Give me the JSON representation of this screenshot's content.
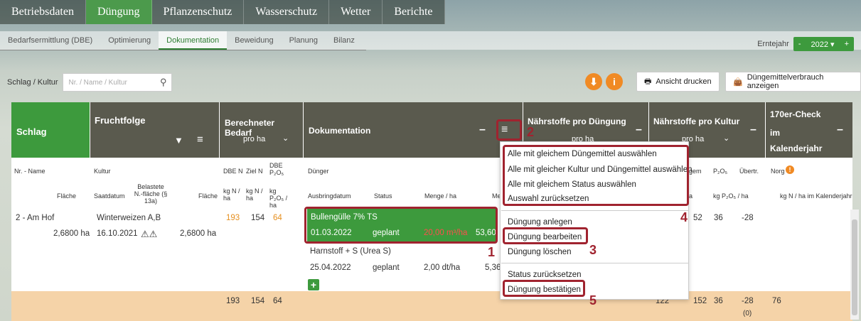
{
  "topnav": [
    "Betriebsdaten",
    "Düngung",
    "Pflanzenschutz",
    "Wasserschutz",
    "Wetter",
    "Berichte"
  ],
  "subnav": [
    "Bedarfsermittlung (DBE)",
    "Optimierung",
    "Dokumentation",
    "Beweidung",
    "Planung",
    "Bilanz"
  ],
  "erntejahr": {
    "label": "Erntejahr",
    "year": "2022 ▾",
    "minus": "-",
    "plus": "+"
  },
  "filter": {
    "label": "Schlag / Kultur",
    "placeholder": "Nr. / Name / Kultur"
  },
  "buttons": {
    "print": "Ansicht drucken",
    "usage": "Düngemittelverbrauch anzeigen",
    "info_i": "i",
    "download": "⬇"
  },
  "headers": {
    "schlag": "Schlag",
    "fruchtfolge": "Fruchtfolge",
    "bedarf": "Berechneter Bedarf",
    "bedarf_sub": "pro ha",
    "doku": "Dokumentation",
    "naehr_dueng": "Nährstoffe pro Düngung",
    "naehr_dueng_sub": "pro ha",
    "naehr_kultur": "Nährstoffe pro Kultur",
    "naehr_kultur_sub": "pro ha",
    "check1": "170er-Check",
    "check2": "im",
    "check3": "Kalenderjahr"
  },
  "subheaders": {
    "nrname": "Nr. - Name",
    "flaeche": "Fläche",
    "kultur": "Kultur",
    "saatdatum": "Saatdatum",
    "belastete": "Belastete N.-fläche (§ 13a)",
    "flaeche2": "Fläche",
    "dben": "DBE N",
    "zieln": "Ziel N",
    "dbep": "DBE P₂O₅",
    "kgn1": "kg N / ha",
    "kgn2": "kg N / ha",
    "kgp": "kg P₂O₅ / ha",
    "duenger": "Dünger",
    "ausbring": "Ausbringdatum",
    "status": "Status",
    "menge": "Menge / ha",
    "me": "Me",
    "p2o5": "P₂O₅",
    "uebertr": "Übertr.",
    "norg": "Norg",
    "kgpha": "kg P₂O₅ / ha",
    "kgnkal": "kg N / ha im Kalenderjahr",
    "a": "a",
    "gem": "gem"
  },
  "row": {
    "schlag": "2 - Am Hof",
    "flaeche": "2,6800 ha",
    "kultur": "Winterweizen A,B",
    "saat": "16.10.2021",
    "fl": "2,6800 ha",
    "dben": "193",
    "zieln": "154",
    "dbep": "64",
    "nk1": "52",
    "nk2": "36",
    "nk3": "-28"
  },
  "duenger1": {
    "name": "Bullengülle 7% TS",
    "date": "01.03.2022",
    "status": "geplant",
    "menge": "20,00 m³/ha",
    "me": "53,60"
  },
  "duenger2": {
    "name": "Harnstoff + S (Urea S)",
    "date": "25.04.2022",
    "status": "geplant",
    "menge": "2,00 dt/ha",
    "me": "5,36"
  },
  "foot": {
    "dben": "193",
    "zieln": "154",
    "dbep": "64",
    "k1": "122",
    "k2": "152",
    "k3": "36",
    "k4": "-28",
    "k4b": "(0)",
    "check": "76"
  },
  "menu": [
    "Alle mit gleichem Düngemittel auswählen",
    "Alle mit gleicher Kultur und Düngemittel auswählen",
    "Alle mit gleichem Status auswählen",
    "Auswahl zurücksetzen",
    "Düngung anlegen",
    "Düngung bearbeiten",
    "Düngung löschen",
    "Status zurücksetzen",
    "Düngung bestätigen"
  ],
  "annotations": [
    "1",
    "2",
    "3",
    "4",
    "5"
  ]
}
